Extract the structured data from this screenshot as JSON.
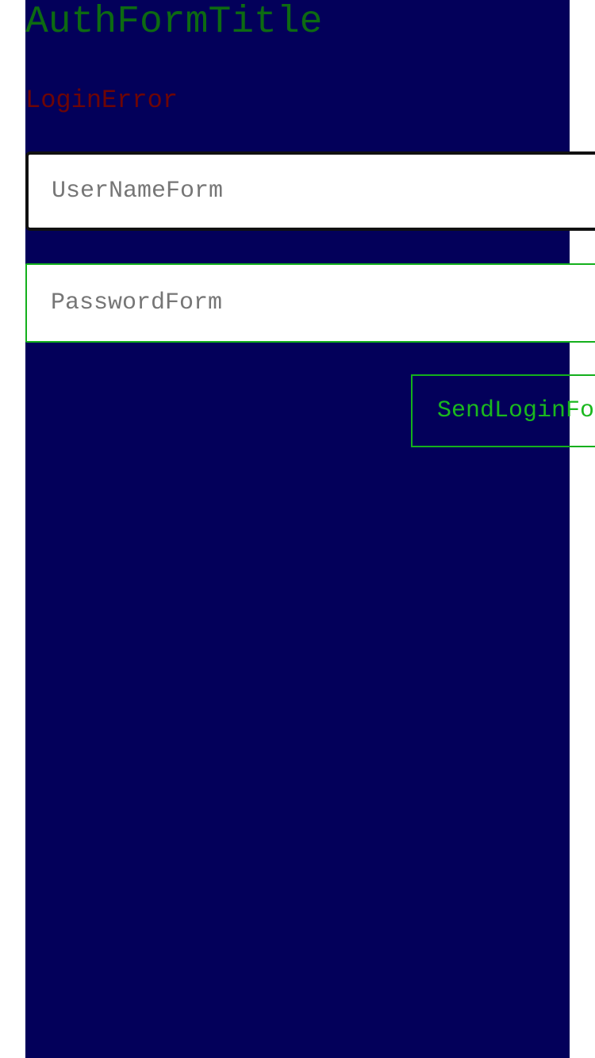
{
  "colors": {
    "panel_background": "#03005a",
    "title": "#0d6a12",
    "error": "#6e0505",
    "accent_green": "#14b01c"
  },
  "form": {
    "title": "AuthFormTitle",
    "error": "LoginError",
    "username_placeholder": "UserNameForm",
    "password_placeholder": "PasswordForm",
    "send_label": "SendLoginForm"
  }
}
